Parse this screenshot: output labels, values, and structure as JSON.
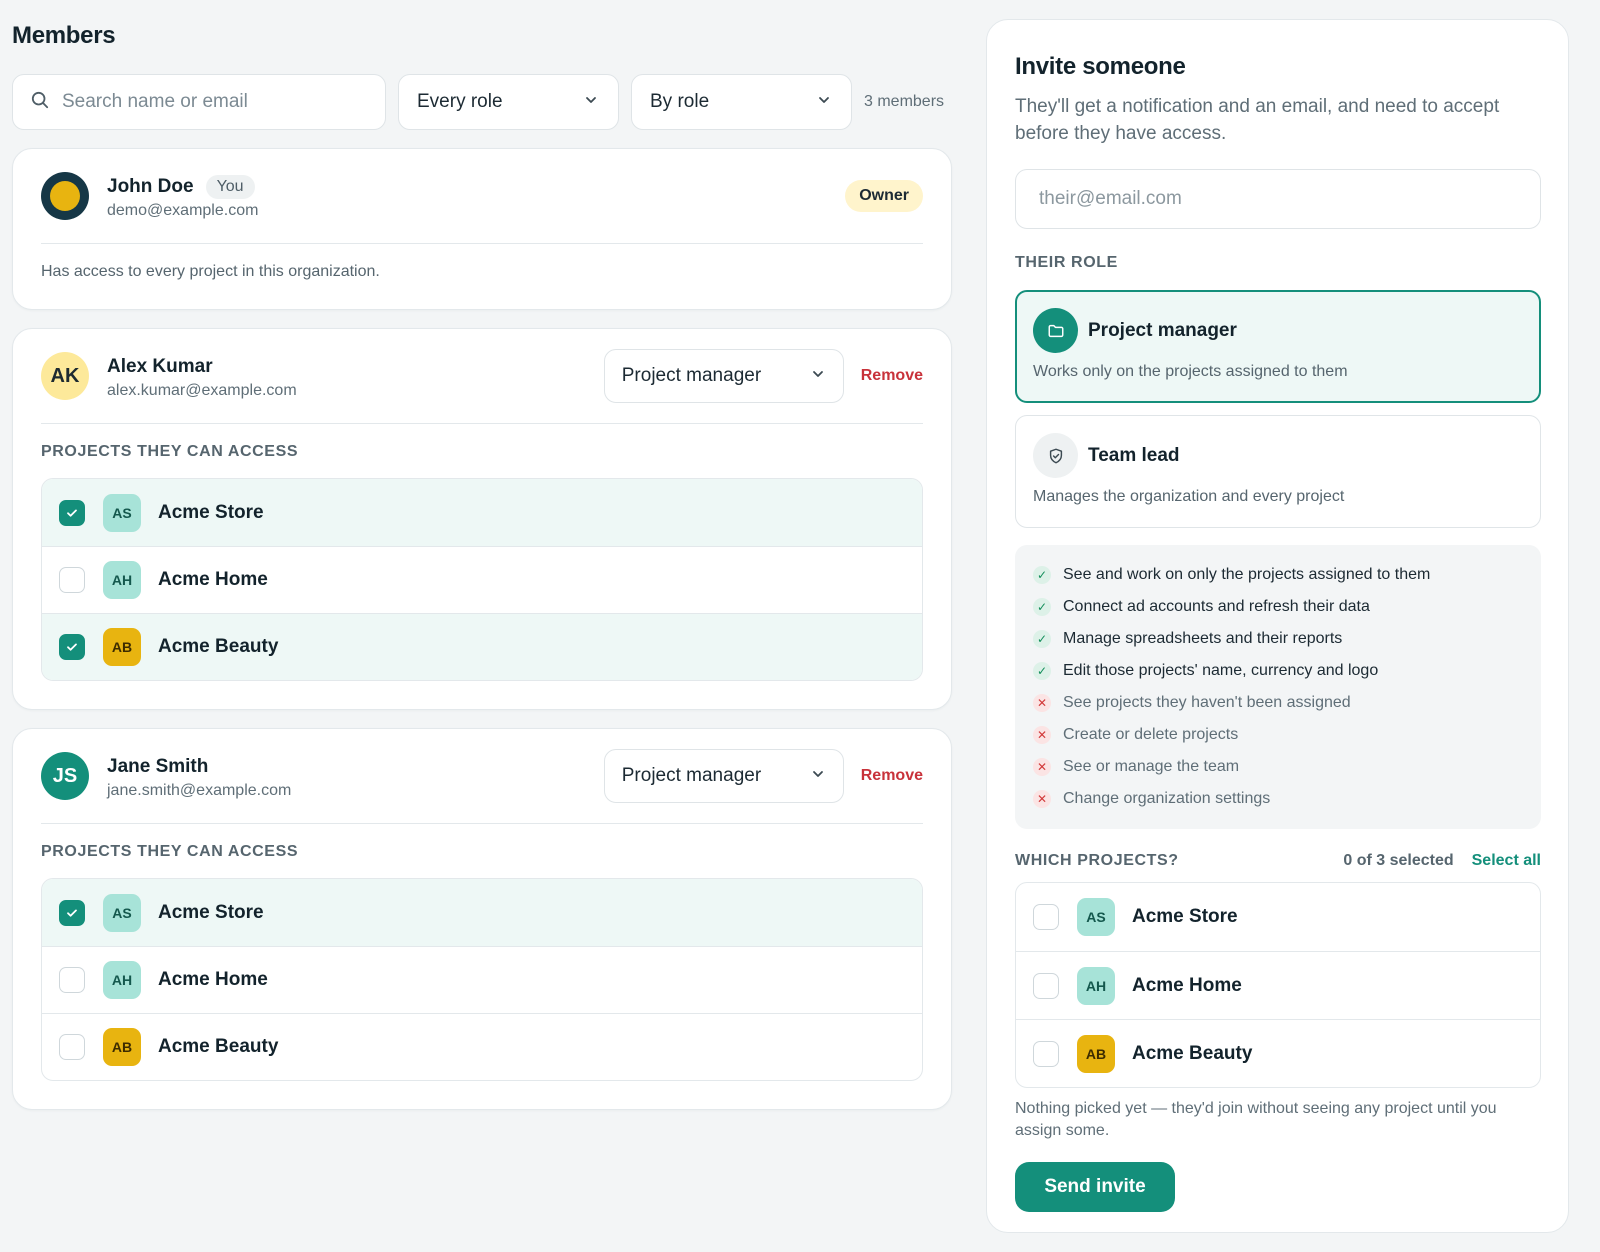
{
  "members": {
    "title": "Members",
    "search_placeholder": "Search name or email",
    "role_filter": "Every role",
    "sort": "By role",
    "count": "3 members",
    "owner": {
      "name": "John Doe",
      "you_badge": "You",
      "email": "demo@example.com",
      "badge": "Owner",
      "note": "Has access to every project in this organization."
    },
    "list": [
      {
        "initials": "AK",
        "name": "Alex Kumar",
        "email": "alex.kumar@example.com",
        "role": "Project manager",
        "remove": "Remove",
        "projects_label": "PROJECTS THEY CAN ACCESS",
        "projects": [
          {
            "badge": "AS",
            "name": "Acme Store",
            "checked": true
          },
          {
            "badge": "AH",
            "name": "Acme Home",
            "checked": false
          },
          {
            "badge": "AB",
            "name": "Acme Beauty",
            "checked": true
          }
        ]
      },
      {
        "initials": "JS",
        "name": "Jane Smith",
        "email": "jane.smith@example.com",
        "role": "Project manager",
        "remove": "Remove",
        "projects_label": "PROJECTS THEY CAN ACCESS",
        "projects": [
          {
            "badge": "AS",
            "name": "Acme Store",
            "checked": true
          },
          {
            "badge": "AH",
            "name": "Acme Home",
            "checked": false
          },
          {
            "badge": "AB",
            "name": "Acme Beauty",
            "checked": false
          }
        ]
      }
    ]
  },
  "invite": {
    "title": "Invite someone",
    "description": "They'll get a notification and an email, and need to accept before they have access.",
    "email_placeholder": "their@email.com",
    "role_label": "THEIR ROLE",
    "roles": [
      {
        "name": "Project manager",
        "desc": "Works only on the projects assigned to them",
        "icon": "folder-icon",
        "selected": true
      },
      {
        "name": "Team lead",
        "desc": "Manages the organization and every project",
        "icon": "shield-icon",
        "selected": false
      }
    ],
    "permissions": [
      {
        "text": "See and work on only the projects assigned to them",
        "allowed": true
      },
      {
        "text": "Connect ad accounts and refresh their data",
        "allowed": true
      },
      {
        "text": "Manage spreadsheets and their reports",
        "allowed": true
      },
      {
        "text": "Edit those projects' name, currency and logo",
        "allowed": true
      },
      {
        "text": "See projects they haven't been assigned",
        "allowed": false
      },
      {
        "text": "Create or delete projects",
        "allowed": false
      },
      {
        "text": "See or manage the team",
        "allowed": false
      },
      {
        "text": "Change organization settings",
        "allowed": false
      }
    ],
    "which_label": "WHICH PROJECTS?",
    "selected_count": "0 of 3 selected",
    "select_all": "Select all",
    "projects": [
      {
        "badge": "AS",
        "name": "Acme Store",
        "checked": false
      },
      {
        "badge": "AH",
        "name": "Acme Home",
        "checked": false
      },
      {
        "badge": "AB",
        "name": "Acme Beauty",
        "checked": false
      }
    ],
    "note": "Nothing picked yet — they'd join without seeing any project until you assign some.",
    "send_label": "Send invite"
  },
  "colors": {
    "accent": "#148f7b",
    "danger": "#c8323a",
    "badge_yellow": "#e8b410",
    "badge_mint": "#a7e3d8"
  }
}
